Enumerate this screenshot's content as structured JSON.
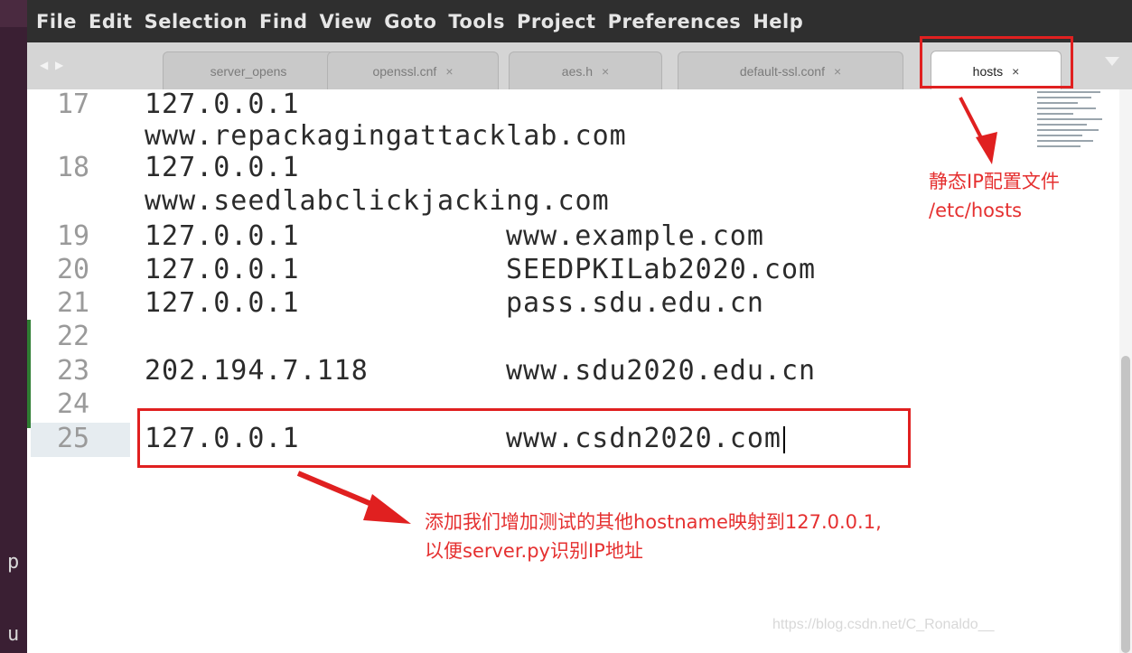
{
  "menubar": {
    "items": [
      "File",
      "Edit",
      "Selection",
      "Find",
      "View",
      "Goto",
      "Tools",
      "Project",
      "Preferences",
      "Help"
    ]
  },
  "tabs": [
    {
      "label": "server_opens",
      "close": ""
    },
    {
      "label": "openssl.cnf",
      "close": "×"
    },
    {
      "label": "aes.h",
      "close": "×"
    },
    {
      "label": "default-ssl.conf",
      "close": "×"
    },
    {
      "label": "hosts",
      "close": "×",
      "active": true
    }
  ],
  "tab_nav": "◀ ▶",
  "editor": {
    "lines": [
      {
        "num": "17",
        "ip": "127.0.0.1"
      },
      {
        "num": "",
        "ip": "www.repackagingattacklab.com"
      },
      {
        "num": "18",
        "ip": "127.0.0.1"
      },
      {
        "num": "",
        "ip": "www.seedlabclickjacking.com"
      },
      {
        "num": "19",
        "ip": "127.0.0.1",
        "host": "www.example.com"
      },
      {
        "num": "20",
        "ip": "127.0.0.1",
        "host": "SEEDPKILab2020.com"
      },
      {
        "num": "21",
        "ip": "127.0.0.1",
        "host": "pass.sdu.edu.cn"
      },
      {
        "num": "22",
        "ip": ""
      },
      {
        "num": "23",
        "ip": "202.194.7.118",
        "host": "www.sdu2020.edu.cn"
      },
      {
        "num": "24",
        "ip": ""
      },
      {
        "num": "25",
        "ip": "127.0.0.1",
        "host": "www.csdn2020.com"
      }
    ]
  },
  "annotations": {
    "file_note_line1": "静态IP配置文件",
    "file_note_line2": "/etc/hosts",
    "add_note_line1": "添加我们增加测试的其他hostname映射到127.0.0.1,",
    "add_note_line2": "以便server.py识别IP地址"
  },
  "desktop_glyphs": {
    "p": "p",
    "u": "u"
  },
  "watermark": "https://blog.csdn.net/C_Ronaldo__",
  "colors": {
    "annotation_red": "#e02020",
    "menubar": "#2f2f2f",
    "tabbar": "#d5d5d5",
    "gutter_marker": "#2e7d32"
  }
}
